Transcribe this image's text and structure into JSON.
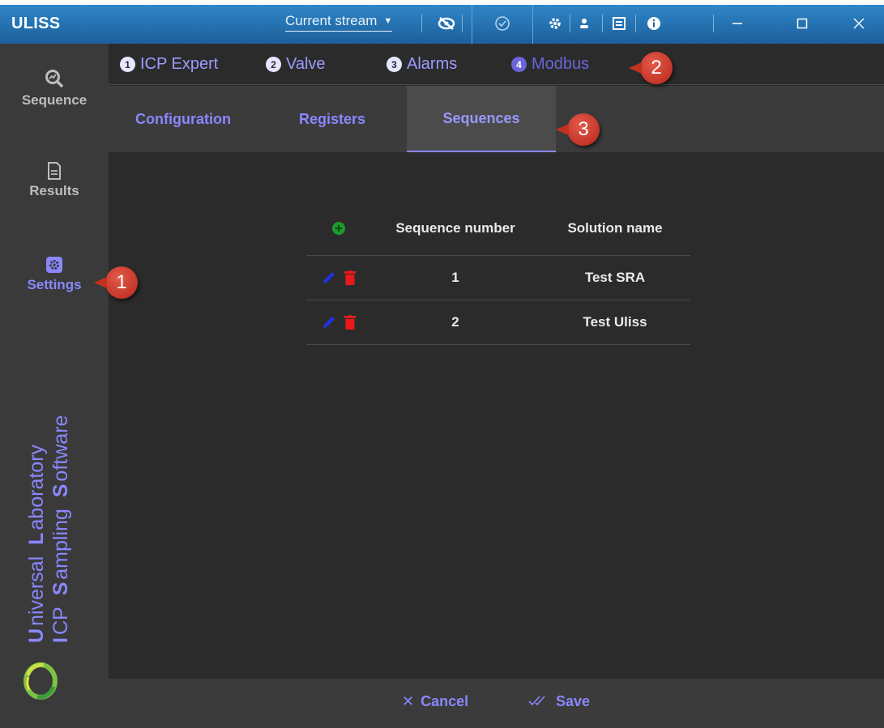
{
  "app": {
    "title": "ULISS"
  },
  "titlebar": {
    "stream_label": "Current stream",
    "icons": [
      "eye-slash-icon",
      "check-circle-icon",
      "gear-icon",
      "user-icon",
      "document-icon",
      "info-icon",
      "minimize-icon",
      "maximize-icon",
      "close-icon"
    ]
  },
  "sidebar": {
    "items": [
      {
        "label": "Sequence",
        "icon": "sequence-icon"
      },
      {
        "label": "Results",
        "icon": "results-icon"
      },
      {
        "label": "Settings",
        "icon": "settings-icon",
        "active": true
      }
    ],
    "brand": {
      "line1": {
        "initial1": "U",
        "rest1": "niversal",
        "initial2": "L",
        "rest2": "aboratory"
      },
      "line2": {
        "initial1": "I",
        "rest1": "CP",
        "initial2": "S",
        "rest2": "ampling",
        "initial3": "S",
        "rest3": "oftware"
      }
    }
  },
  "top_tabs": [
    {
      "num": "1",
      "label": "ICP Expert"
    },
    {
      "num": "2",
      "label": "Valve"
    },
    {
      "num": "3",
      "label": "Alarms"
    },
    {
      "num": "4",
      "label": "Modbus",
      "active": true
    }
  ],
  "sub_tabs": [
    {
      "label": "Configuration"
    },
    {
      "label": "Registers"
    },
    {
      "label": "Sequences",
      "active": true
    }
  ],
  "table": {
    "headers": {
      "number": "Sequence number",
      "solution": "Solution name"
    },
    "rows": [
      {
        "number": "1",
        "solution": "Test SRA"
      },
      {
        "number": "2",
        "solution": "Test Uliss"
      }
    ]
  },
  "footer": {
    "cancel": "Cancel",
    "save": "Save"
  },
  "callouts": [
    "1",
    "2",
    "3"
  ],
  "colors": {
    "accent": "#8a87ff",
    "titlebar": "#1c5f9b",
    "delete": "#e81919",
    "edit": "#1e33e8",
    "add": "#1f9a2e",
    "callout": "#c2321f"
  }
}
